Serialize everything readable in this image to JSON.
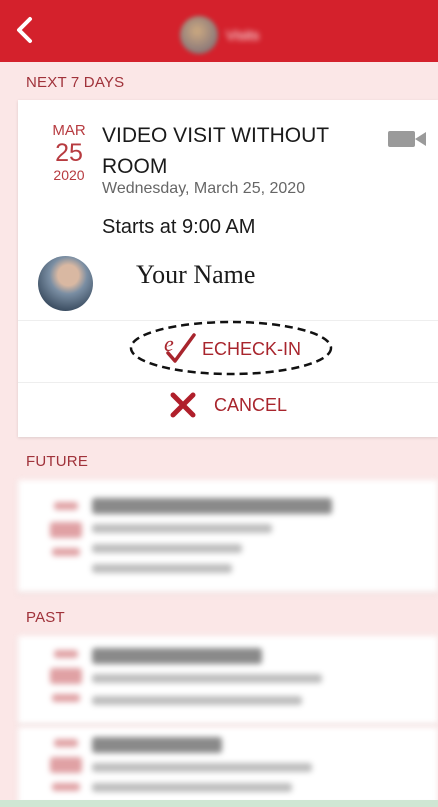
{
  "header": {
    "back_glyph": "<",
    "avatar_icon": "user-avatar",
    "title": "Visits"
  },
  "sections": {
    "next": "NEXT 7 DAYS",
    "future": "FUTURE",
    "past": "PAST"
  },
  "upcoming_visit": {
    "month": "MAR",
    "day": "25",
    "year": "2020",
    "title": "VIDEO VISIT WITHOUT ROOM",
    "date_full": "Wednesday, March 25, 2020",
    "start_time": "Starts at 9:00 AM",
    "provider_name": "Your Name",
    "type_icon": "video-camera-icon",
    "echeckin_label": "ECHECK-IN",
    "cancel_label": "CANCEL"
  },
  "colors": {
    "brand_red": "#d4212c",
    "accent_red": "#a8252d",
    "section_bg": "#fbe7e7"
  }
}
